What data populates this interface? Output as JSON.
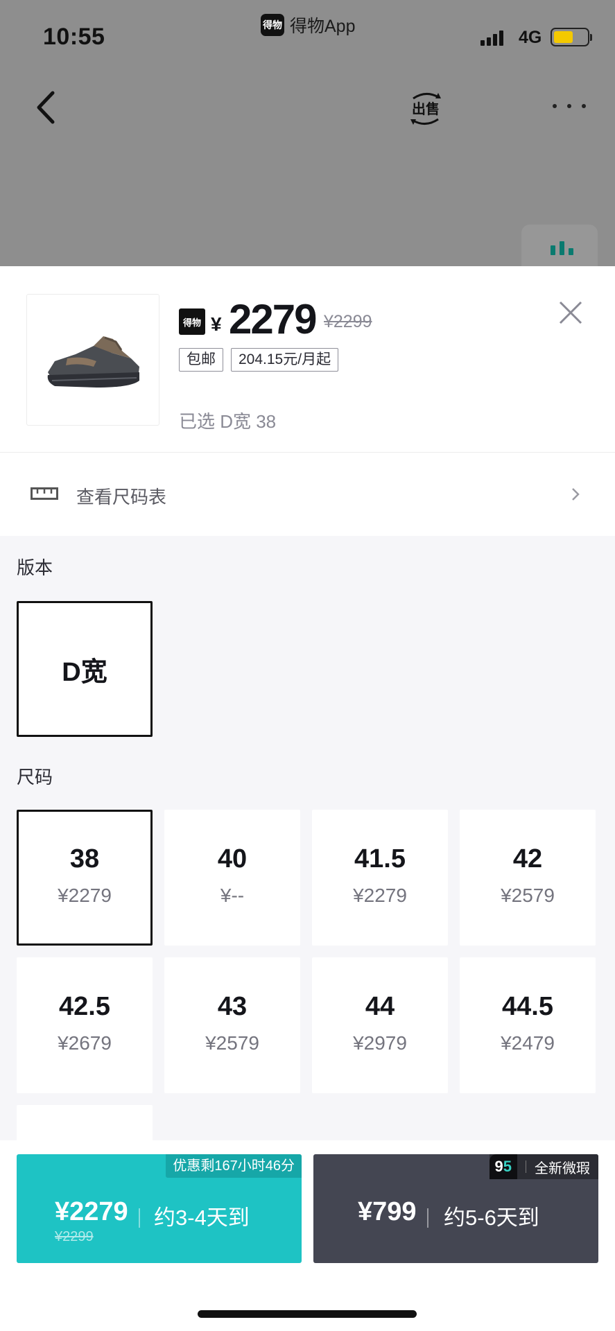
{
  "status_bar": {
    "time": "10:55",
    "app_name": "得物App",
    "app_icon_text": "得物",
    "network": "4G",
    "battery_level": 0.58
  },
  "nav": {
    "sell_label": "出售"
  },
  "product": {
    "logo_text": "得物",
    "currency": "¥",
    "price": "2279",
    "original_price": "¥2299",
    "tags": [
      "包邮",
      "204.15元/月起"
    ],
    "selected_text": "已选 D宽 38"
  },
  "size_chart": {
    "label": "查看尺码表"
  },
  "version": {
    "label": "版本",
    "options": [
      "D宽"
    ]
  },
  "sizes": {
    "label": "尺码",
    "items": [
      {
        "size": "38",
        "price": "¥2279"
      },
      {
        "size": "40",
        "price": "¥--"
      },
      {
        "size": "41.5",
        "price": "¥2279"
      },
      {
        "size": "42",
        "price": "¥2579"
      },
      {
        "size": "42.5",
        "price": "¥2679"
      },
      {
        "size": "43",
        "price": "¥2579"
      },
      {
        "size": "44",
        "price": "¥2979"
      },
      {
        "size": "44.5",
        "price": "¥2479"
      }
    ]
  },
  "bottom": {
    "fast": {
      "promo": "优惠剩167小时46分",
      "price": "¥2279",
      "original_price": "¥2299",
      "eta": "约3-4天到"
    },
    "used": {
      "badge_num": "9",
      "badge_num2": "5",
      "badge_text": "全新微瑕",
      "price": "¥799",
      "eta": "约5-6天到"
    }
  },
  "colors": {
    "accent_teal": "#1ec3c4",
    "dark_button": "#444652"
  }
}
